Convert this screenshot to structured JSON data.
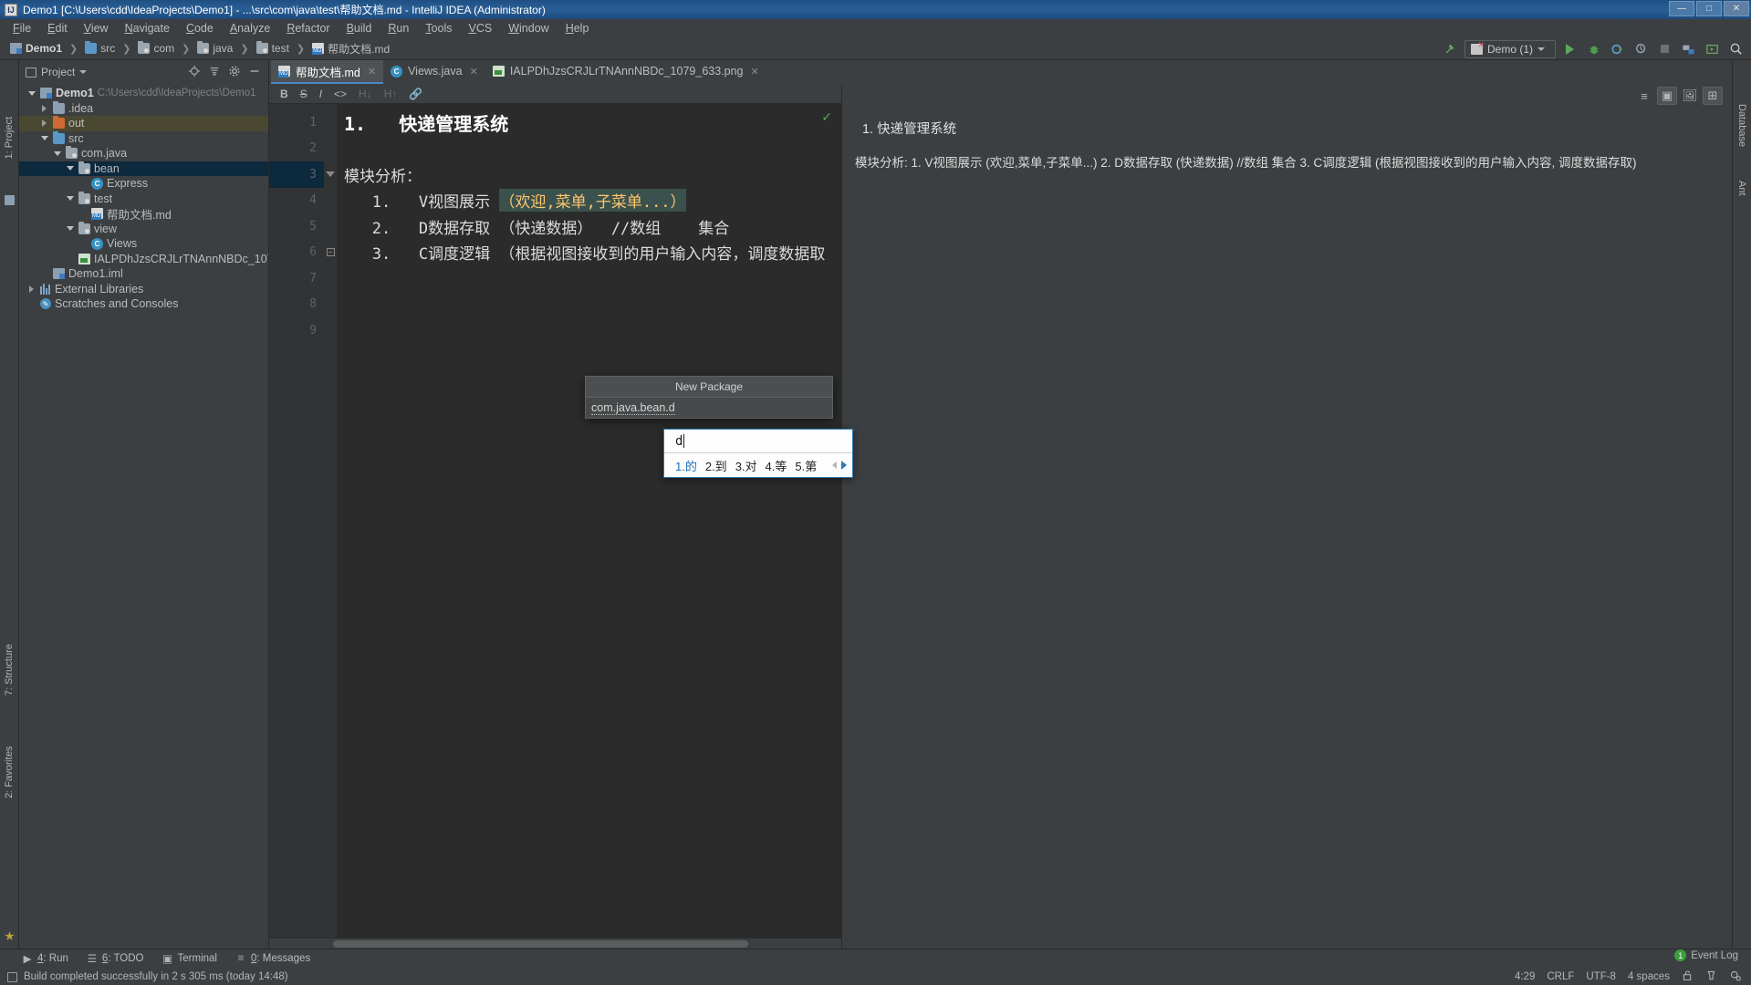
{
  "window": {
    "title": "Demo1 [C:\\Users\\cdd\\IdeaProjects\\Demo1] - ...\\src\\com\\java\\test\\帮助文档.md - IntelliJ IDEA (Administrator)",
    "app_icon": "IJ",
    "minimize": "—",
    "maximize": "□",
    "close": "✕"
  },
  "menubar": {
    "items": [
      "File",
      "Edit",
      "View",
      "Navigate",
      "Code",
      "Analyze",
      "Refactor",
      "Build",
      "Run",
      "Tools",
      "VCS",
      "Window",
      "Help"
    ]
  },
  "breadcrumb": {
    "items": [
      {
        "label": "Demo1",
        "icon": "module-icon",
        "bold": true
      },
      {
        "label": "src",
        "icon": "folder-blue-icon",
        "bold": false
      },
      {
        "label": "com",
        "icon": "package-icon",
        "bold": false
      },
      {
        "label": "java",
        "icon": "package-icon",
        "bold": false
      },
      {
        "label": "test",
        "icon": "package-icon",
        "bold": false
      },
      {
        "label": "帮助文档.md",
        "icon": "markdown-icon",
        "bold": false
      }
    ],
    "separator": "❯"
  },
  "toolbar": {
    "build_label": "build-hammer-icon",
    "run_config": "Demo (1)",
    "run_label": "run-icon",
    "debug_label": "debug-icon",
    "run_coverage_label": "run-with-coverage-icon",
    "profile_label": "profiler-icon",
    "stop_label": "stop-icon",
    "project_structure_label": "project-structure-icon",
    "updates_label": "updates-icon",
    "search_label": "search-everywhere-icon"
  },
  "left_stripes": [
    {
      "label": "1: Project"
    },
    {
      "label": "7: Structure"
    },
    {
      "label": "2: Favorites"
    }
  ],
  "right_stripes": [
    {
      "label": "Database"
    },
    {
      "label": "Ant"
    }
  ],
  "project_panel": {
    "title": "Project",
    "dropdown": "▼",
    "tools": [
      "locate-icon",
      "collapse-all-icon",
      "settings-gear-icon",
      "hide-icon"
    ],
    "tree": [
      {
        "depth": 0,
        "twisty": "open",
        "icon": "module-icon",
        "label": "Demo1",
        "bold": true,
        "path": "C:\\Users\\cdd\\IdeaProjects\\Demo1",
        "state": "none"
      },
      {
        "depth": 1,
        "twisty": "closed",
        "icon": "folder-icon",
        "label": ".idea",
        "bold": false,
        "path": "",
        "state": "none"
      },
      {
        "depth": 1,
        "twisty": "closed",
        "icon": "folder-orange-icon",
        "label": "out",
        "bold": false,
        "path": "",
        "state": "highlight"
      },
      {
        "depth": 1,
        "twisty": "open",
        "icon": "folder-blue-icon",
        "label": "src",
        "bold": false,
        "path": "",
        "state": "none"
      },
      {
        "depth": 2,
        "twisty": "open",
        "icon": "package-icon",
        "label": "com.java",
        "bold": false,
        "path": "",
        "state": "none"
      },
      {
        "depth": 3,
        "twisty": "open",
        "icon": "package-icon",
        "label": "bean",
        "bold": false,
        "path": "",
        "state": "selected"
      },
      {
        "depth": 4,
        "twisty": "none",
        "icon": "class-icon",
        "label": "Express",
        "bold": false,
        "path": "",
        "state": "none"
      },
      {
        "depth": 3,
        "twisty": "open",
        "icon": "package-icon",
        "label": "test",
        "bold": false,
        "path": "",
        "state": "none"
      },
      {
        "depth": 4,
        "twisty": "none",
        "icon": "markdown-icon",
        "label": "帮助文档.md",
        "bold": false,
        "path": "",
        "state": "none"
      },
      {
        "depth": 3,
        "twisty": "open",
        "icon": "package-icon",
        "label": "view",
        "bold": false,
        "path": "",
        "state": "none"
      },
      {
        "depth": 4,
        "twisty": "none",
        "icon": "class-icon",
        "label": "Views",
        "bold": false,
        "path": "",
        "state": "none"
      },
      {
        "depth": 3,
        "twisty": "none",
        "icon": "image-icon",
        "label": "IALPDhJzsCRJLrTNAnnNBDc_1079_633.png",
        "bold": false,
        "path": "",
        "state": "none"
      },
      {
        "depth": 1,
        "twisty": "none",
        "icon": "module-icon",
        "label": "Demo1.iml",
        "bold": false,
        "path": "",
        "state": "none"
      },
      {
        "depth": 0,
        "twisty": "closed",
        "icon": "library-icon",
        "label": "External Libraries",
        "bold": false,
        "path": "",
        "state": "none"
      },
      {
        "depth": 0,
        "twisty": "none",
        "icon": "scratch-icon",
        "label": "Scratches and Consoles",
        "bold": false,
        "path": "",
        "state": "none"
      }
    ]
  },
  "editor": {
    "tabs": [
      {
        "label": "帮助文档.md",
        "icon": "markdown-icon",
        "active": true,
        "close": "✕"
      },
      {
        "label": "Views.java",
        "icon": "class-icon",
        "active": false,
        "close": "✕"
      },
      {
        "label": "IALPDhJzsCRJLrTNAnnNBDc_1079_633.png",
        "icon": "image-icon",
        "active": false,
        "close": "✕"
      }
    ],
    "md_toolbar": [
      {
        "label": "B",
        "name": "bold-button",
        "dim": false
      },
      {
        "label": "S",
        "name": "strikethrough-button",
        "dim": false
      },
      {
        "label": "I",
        "name": "italic-button",
        "dim": false
      },
      {
        "label": "<>",
        "name": "code-button",
        "dim": false
      },
      {
        "label": "H↓",
        "name": "header-down-button",
        "dim": true
      },
      {
        "label": "H↑",
        "name": "header-up-button",
        "dim": true
      },
      {
        "label": "🔗",
        "name": "link-button",
        "dim": true
      }
    ],
    "lines": [
      {
        "num": "1",
        "text": "1.   快递管理系统",
        "style": "big",
        "fold": "none",
        "highlight": false
      },
      {
        "num": "2",
        "text": "",
        "style": "normal",
        "fold": "none",
        "highlight": false
      },
      {
        "num": "3",
        "text": "模块分析：",
        "style": "hd",
        "fold": "collapse",
        "highlight": true
      },
      {
        "num": "4",
        "text_pre": "   1.   V视图展示 ",
        "text_hl": "（欢迎,菜单,子菜单...）",
        "text_post": "",
        "style": "hd",
        "fold": "none",
        "highlight": false
      },
      {
        "num": "5",
        "text": "   2.   D数据存取 （快递数据）  //数组    集合",
        "style": "hd",
        "fold": "none",
        "highlight": false
      },
      {
        "num": "6",
        "text": "   3.   C调度逻辑 （根据视图接收到的用户输入内容，调度数据取",
        "style": "hd",
        "fold": "end",
        "highlight": false
      },
      {
        "num": "7",
        "text": "",
        "style": "normal",
        "fold": "none",
        "highlight": false
      },
      {
        "num": "8",
        "text": "",
        "style": "normal",
        "fold": "none",
        "highlight": false
      },
      {
        "num": "9",
        "text": "",
        "style": "normal",
        "fold": "none",
        "highlight": false
      }
    ],
    "inspection_ok": "✓"
  },
  "preview": {
    "toolbar_buttons": [
      {
        "name": "editor-only-button",
        "glyph": "≡",
        "on": false
      },
      {
        "name": "editor-and-preview-button",
        "glyph": "▣",
        "on": true
      },
      {
        "name": "preview-only-button",
        "glyph": "🖼",
        "on": false
      },
      {
        "name": "split-layout-button",
        "glyph": "⊞",
        "on": true
      }
    ],
    "heading": "1. 快递管理系统",
    "paragraph": "模块分析: 1. V视图展示 (欢迎,菜单,子菜单...) 2. D数据存取 (快递数据) //数组 集合 3. C调度逻辑 (根据视图接收到的用户输入内容, 调度数据存取)"
  },
  "new_package_popup": {
    "title": "New Package",
    "value": "com.java.bean.d"
  },
  "ime_popup": {
    "composition": "d",
    "candidates": [
      "1.的",
      "2.到",
      "3.对",
      "4.等",
      "5.第"
    ],
    "prev_arrow": "◀",
    "next_arrow": "▶"
  },
  "tool_windows": [
    {
      "num": "4",
      "label": ": Run",
      "icon": "run-icon"
    },
    {
      "num": "6",
      "label": ": TODO",
      "icon": "todo-icon"
    },
    {
      "num": "",
      "label": "Terminal",
      "icon": "terminal-icon"
    },
    {
      "num": "0",
      "label": ": Messages",
      "icon": "messages-icon"
    }
  ],
  "statusbar": {
    "message": "Build completed successfully in 2 s 305 ms (today 14:48)",
    "event_log": "Event Log",
    "event_count": "1",
    "caret": "4:29",
    "line_sep": "CRLF",
    "encoding": "UTF-8",
    "indent": "4 spaces",
    "lock_icon": "unlocked-icon",
    "inspector_icon": "inspection-icon",
    "gear_icon": "settings-icon"
  },
  "colors": {
    "accent_blue": "#4a88c7",
    "selection": "#0d293e",
    "editor_bg": "#2b2b2b",
    "panel_bg": "#3c3f41",
    "highlight_row": "#4b4832",
    "green": "#5ba85b"
  }
}
